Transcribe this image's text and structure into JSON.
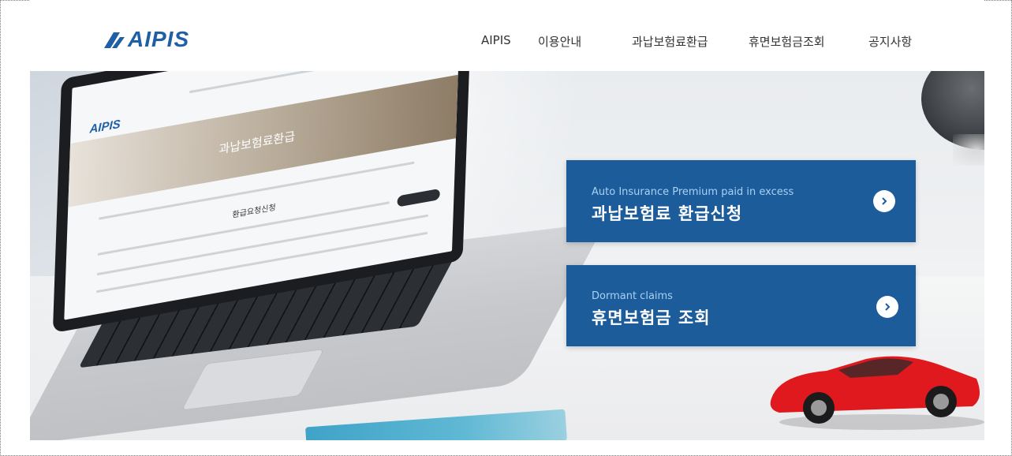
{
  "header": {
    "logo_text": "AIPIS",
    "brand_color": "#1f5fa6",
    "nav": [
      {
        "label": "AIPIS"
      },
      {
        "label": "이용안내"
      },
      {
        "label": "과납보험료환급"
      },
      {
        "label": "휴면보험금조회"
      },
      {
        "label": "공지사항"
      }
    ]
  },
  "hero": {
    "laptop_screen": {
      "logo_text": "AIPIS",
      "banner_title": "과납보험료환급",
      "section_title": "환급요청신청"
    }
  },
  "cards": [
    {
      "subtitle": "Auto Insurance Premium paid in excess",
      "title": "과납보험료 환급신청",
      "icon": "chevron-right-icon"
    },
    {
      "subtitle": "Dormant claims",
      "title": "휴면보험금 조회",
      "icon": "chevron-right-icon"
    }
  ],
  "colors": {
    "card_bg": "#1c5c9a",
    "card_subtitle": "#a9d1f5",
    "car_red": "#e0191e"
  }
}
